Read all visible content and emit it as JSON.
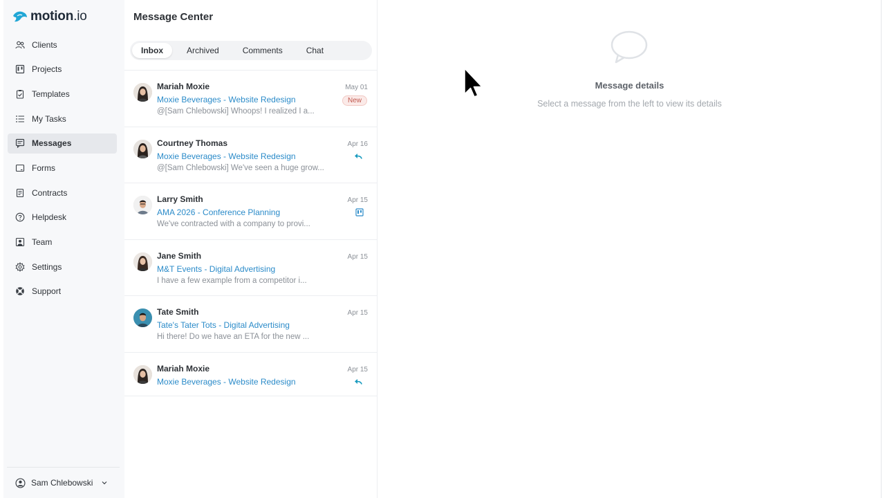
{
  "app": {
    "logo_name": "motion",
    "logo_suffix": ".io"
  },
  "sidebar": {
    "items": [
      {
        "label": "Clients",
        "icon": "users-icon"
      },
      {
        "label": "Projects",
        "icon": "board-icon"
      },
      {
        "label": "Templates",
        "icon": "clipboard-icon"
      },
      {
        "label": "My Tasks",
        "icon": "list-icon"
      },
      {
        "label": "Messages",
        "icon": "messages-icon",
        "active": true
      },
      {
        "label": "Forms",
        "icon": "form-icon"
      },
      {
        "label": "Contracts",
        "icon": "document-icon"
      },
      {
        "label": "Helpdesk",
        "icon": "help-icon"
      },
      {
        "label": "Team",
        "icon": "team-icon"
      },
      {
        "label": "Settings",
        "icon": "gear-icon"
      },
      {
        "label": "Support",
        "icon": "lifebuoy-icon"
      }
    ],
    "user": "Sam Chlebowski"
  },
  "message_center": {
    "title": "Message Center",
    "tabs": [
      "Inbox",
      "Archived",
      "Comments",
      "Chat"
    ],
    "active_tab": "Inbox",
    "messages": [
      {
        "name": "Mariah Moxie",
        "project": "Moxie Beverages - Website Redesign",
        "preview": "@[Sam Chlebowski] Whoops! I realized I a...",
        "date": "May 01",
        "badge": "New"
      },
      {
        "name": "Courtney Thomas",
        "project": "Moxie Beverages - Website Redesign",
        "preview": "@[Sam Chlebowski] We've seen a huge grow...",
        "date": "Apr 16",
        "status_icon": "reply-icon"
      },
      {
        "name": "Larry Smith",
        "project": "AMA 2026 - Conference Planning",
        "preview": "We've contracted with a company to provi...",
        "date": "Apr 15",
        "status_icon": "board-icon"
      },
      {
        "name": "Jane Smith",
        "project": "M&T Events - Digital Advertising",
        "preview": "I have a few example from a competitor i...",
        "date": "Apr 15"
      },
      {
        "name": "Tate Smith",
        "project": "Tate's Tater Tots - Digital Advertising",
        "preview": "Hi there! Do we have an ETA for the new ...",
        "date": "Apr 15"
      },
      {
        "name": "Mariah Moxie",
        "project": "Moxie Beverages - Website Redesign",
        "preview": "",
        "date": "Apr 15",
        "status_icon": "reply-icon"
      }
    ]
  },
  "detail": {
    "title": "Message details",
    "subtitle": "Select a message from the left to view its details",
    "icon": "chat-bubble-icon"
  },
  "colors": {
    "link": "#2b8bc9",
    "accent": "#1a9bbf",
    "badge": "#c0584e"
  }
}
